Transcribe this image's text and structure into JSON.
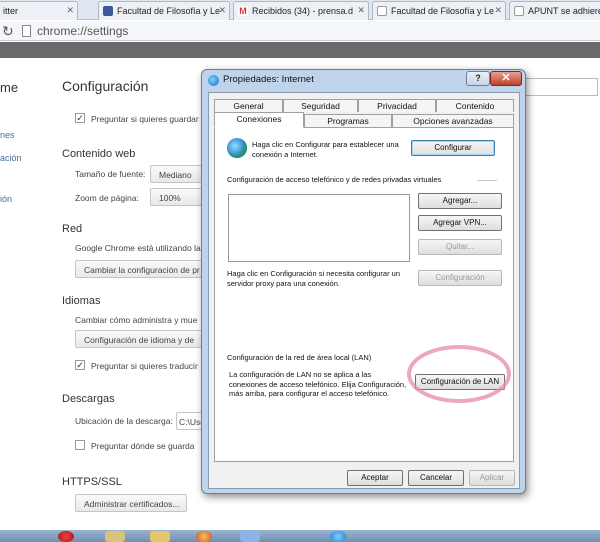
{
  "browser": {
    "tabs": [
      {
        "title": "itter"
      },
      {
        "title": "Facultad de Filosofía y Le"
      },
      {
        "title": "Recibidos (34) - prensa.d"
      },
      {
        "title": "Facultad de Filosofía y Le"
      },
      {
        "title": "APUNT se adhiere"
      }
    ],
    "url": "chrome://settings"
  },
  "settings": {
    "side_items": [
      "me",
      "nes",
      "ación",
      "ión"
    ],
    "title": "Configuración",
    "top_checkbox_label": "Preguntar si quieres guardar",
    "web_content": {
      "heading": "Contenido web",
      "font_size_label": "Tamaño de fuente:",
      "font_size_value": "Mediano",
      "zoom_label": "Zoom de página:",
      "zoom_value": "100%"
    },
    "network": {
      "heading": "Red",
      "text": "Google Chrome está utilizando la",
      "button": "Cambiar la configuración de pr"
    },
    "languages": {
      "heading": "Idiomas",
      "text": "Cambiar cómo administra y mue",
      "button": "Configuración de idioma y de",
      "checkbox_label": "Preguntar si quieres traducir"
    },
    "downloads": {
      "heading": "Descargas",
      "location_label": "Ubicación de la descarga:",
      "location_value": "C:\\Use",
      "ask_label": "Preguntar dónde se guarda"
    },
    "https": {
      "heading": "HTTPS/SSL",
      "button": "Administrar certificados..."
    }
  },
  "dialog": {
    "title": "Propiedades: Internet",
    "help": "?",
    "close": "✕",
    "tabs_row1": [
      "General",
      "Seguridad",
      "Privacidad",
      "Contenido"
    ],
    "tabs_row2": [
      "Conexiones",
      "Programas",
      "Opciones avanzadas"
    ],
    "setup_text": "Haga clic en Configurar para establecer una conexión a Internet.",
    "setup_button": "Configurar",
    "dialup_heading": "Configuración de acceso telefónico y de redes privadas virtuales",
    "add_button": "Agregar...",
    "add_vpn_button": "Agregar VPN...",
    "remove_button": "Quitar...",
    "proxy_text": "Haga clic en Configuración si necesita configurar un servidor proxy para una conexión.",
    "settings_button": "Configuración",
    "lan_heading": "Configuración de la red de área local (LAN)",
    "lan_text": "La configuración de LAN no se aplica a las conexiones de acceso telefónico. Elija Configuración, más arriba, para configurar el acceso telefónico.",
    "lan_button": "Configuración de LAN",
    "ok_button": "Aceptar",
    "cancel_button": "Cancelar",
    "apply_button": "Aplicar"
  },
  "colors": {
    "annotation": "#e07090",
    "dialog_frame": "#bfd4ea",
    "settings_heading": "#333333"
  }
}
